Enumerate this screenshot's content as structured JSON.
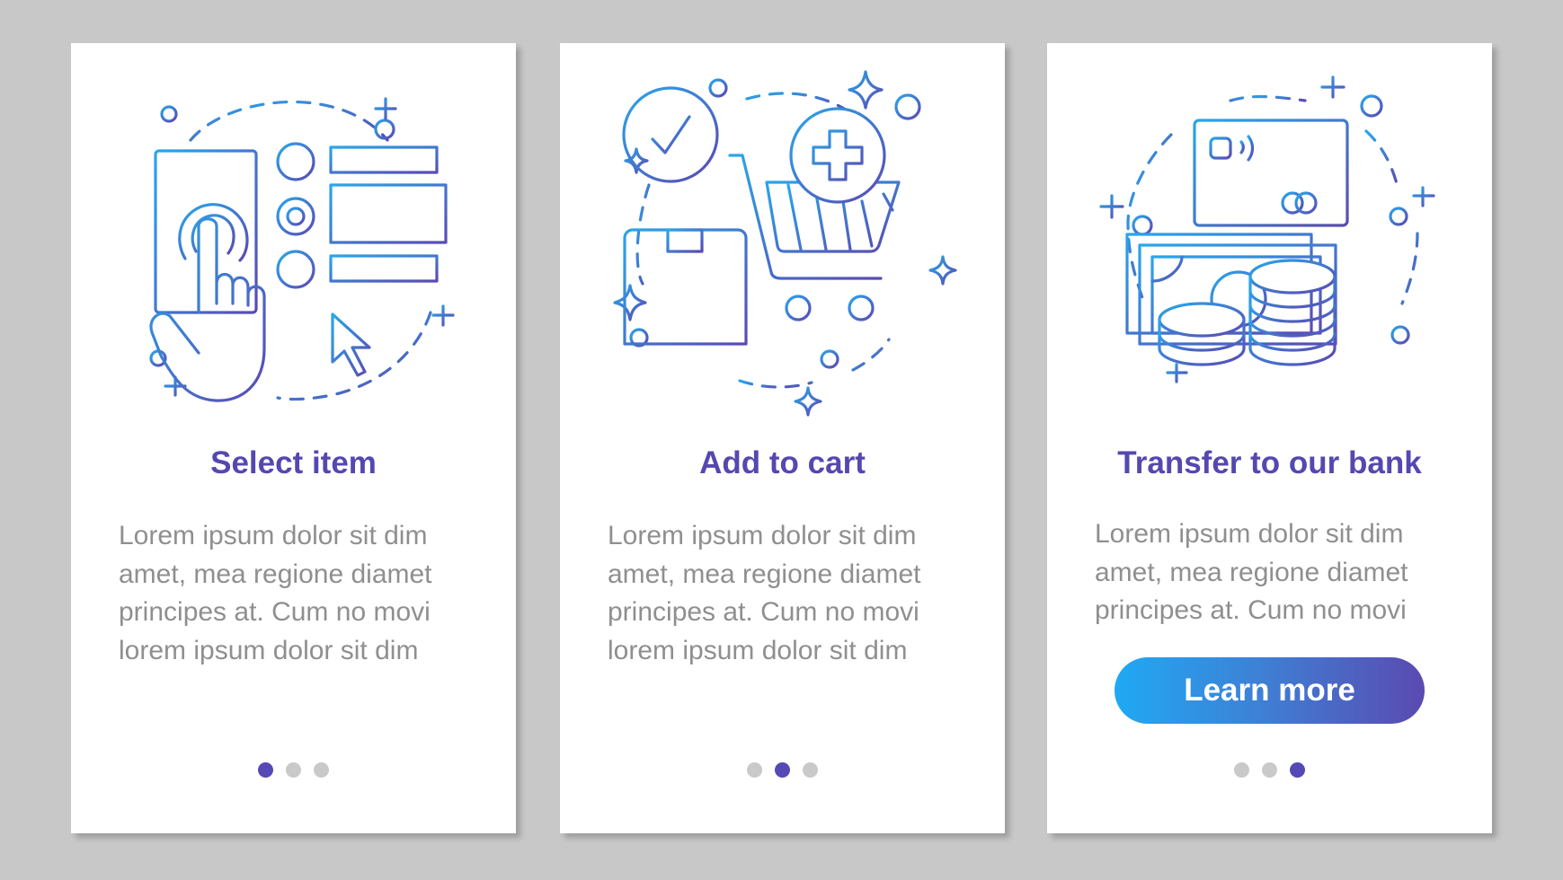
{
  "colors": {
    "background": "#c8c8c8",
    "card": "#ffffff",
    "title": "#5448b0",
    "body_text": "#8f8f8f",
    "icon_gradient_start": "#29a6ea",
    "icon_gradient_end": "#5a4ab3",
    "dot_active": "#5549b5",
    "dot_inactive": "#c9c9c9",
    "button_gradient_start": "#1fa9f4",
    "button_gradient_end": "#5a4ab0"
  },
  "screens": [
    {
      "illustration": "select-item-illustration",
      "icons": [
        "smartphone-icon",
        "tap-hand-icon",
        "radio-buttons-icon",
        "form-fields-icon",
        "cursor-arrow-icon"
      ],
      "title": "Select item",
      "body": "Lorem ipsum dolor sit dim\namet, mea regione diamet\nprincipes at. Cum no movi\nlorem ipsum dolor sit dim",
      "page_index": 1,
      "page_count": 3
    },
    {
      "illustration": "add-to-cart-illustration",
      "icons": [
        "check-circle-icon",
        "package-box-icon",
        "shopping-cart-icon",
        "plus-circle-icon",
        "sparkle-icon"
      ],
      "title": "Add to cart",
      "body": "Lorem ipsum dolor sit dim\namet, mea regione diamet\nprincipes at. Cum no movi\nlorem ipsum dolor sit dim",
      "page_index": 2,
      "page_count": 3
    },
    {
      "illustration": "bank-transfer-illustration",
      "icons": [
        "credit-card-icon",
        "banknotes-icon",
        "coin-stack-icon"
      ],
      "title": "Transfer to our bank",
      "body": "Lorem ipsum dolor sit dim\namet, mea regione diamet\nprincipes at. Cum no movi",
      "button_label": "Learn more",
      "page_index": 3,
      "page_count": 3
    }
  ]
}
